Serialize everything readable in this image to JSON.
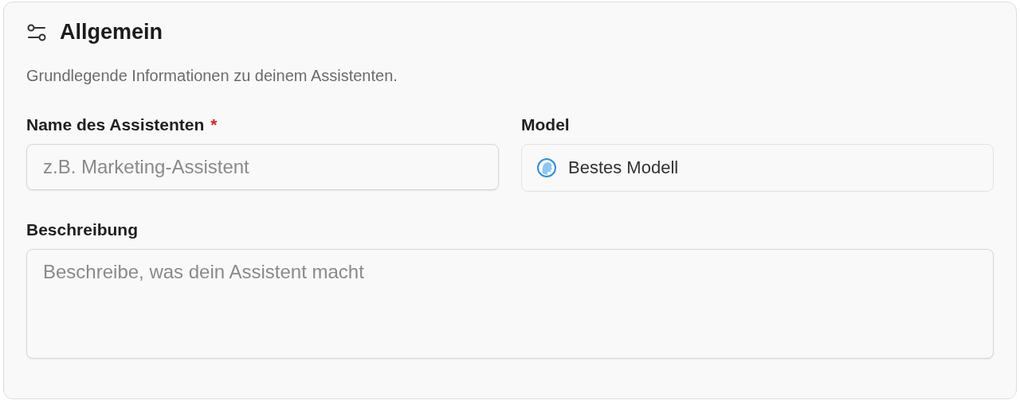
{
  "section": {
    "title": "Allgemein",
    "description": "Grundlegende Informationen zu deinem Assistenten."
  },
  "fields": [
    {
      "kind": "text",
      "label": "Name des Assistenten",
      "required_mark": "*",
      "placeholder": "z.B. Marketing-Assistent"
    },
    {
      "kind": "select",
      "label": "Model",
      "value": "Bestes Modell"
    },
    {
      "kind": "textarea",
      "label": "Beschreibung",
      "placeholder": "Beschreibe, was dein Assistent macht"
    }
  ]
}
